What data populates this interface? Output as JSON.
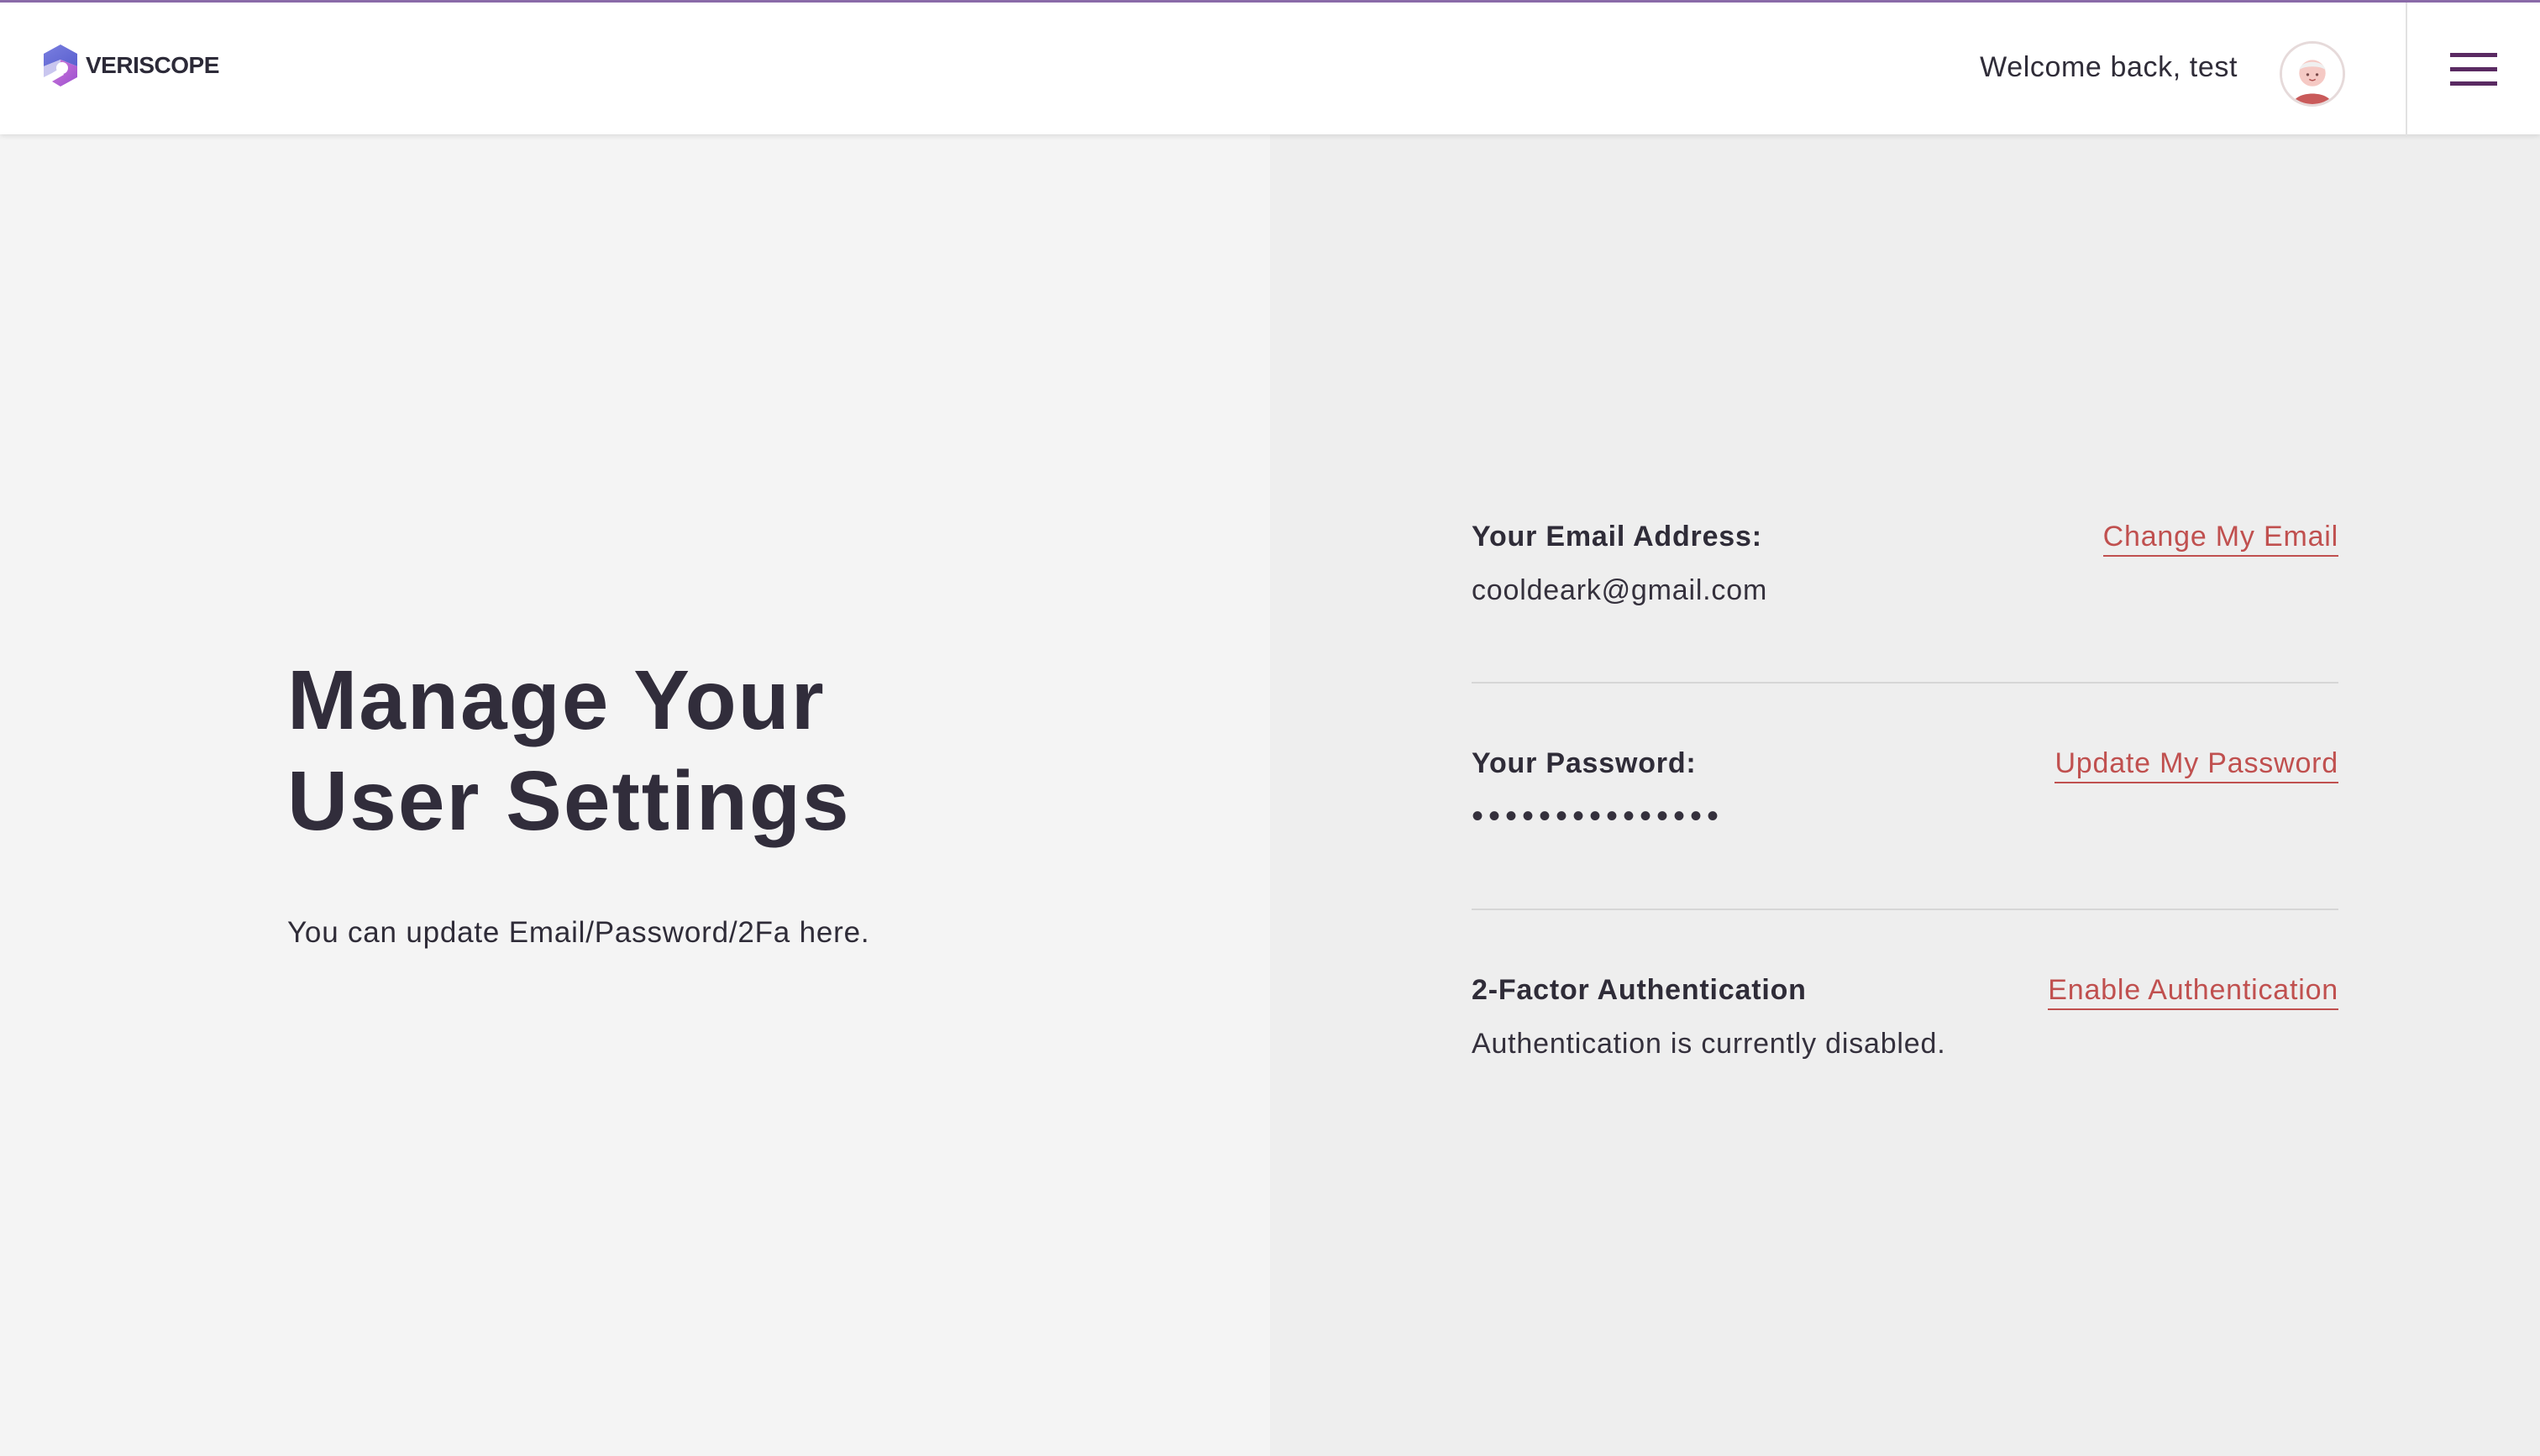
{
  "header": {
    "logo_text": "VERISCOPE",
    "welcome_text": "Welcome back, test"
  },
  "main": {
    "title_line1": "Manage Your",
    "title_line2": "User Settings",
    "subtitle": "You can update Email/Password/2Fa here."
  },
  "settings": {
    "email": {
      "label": "Your Email Address:",
      "value": "cooldeark@gmail.com",
      "action": "Change My Email"
    },
    "password": {
      "label": "Your Password:",
      "value": "•••••••••••••••",
      "action": "Update My Password"
    },
    "two_factor": {
      "label": "2-Factor Authentication",
      "value": "Authentication is currently disabled.",
      "action": "Enable Authentication"
    }
  },
  "colors": {
    "accent_link": "#c0504f",
    "menu_icon": "#5a2a62",
    "header_top_border": "#8a6aa8",
    "title_text": "#312d3b"
  },
  "icons": {
    "logo": "veriscope-logo-icon",
    "avatar": "user-avatar-icon",
    "menu": "hamburger-menu-icon"
  }
}
